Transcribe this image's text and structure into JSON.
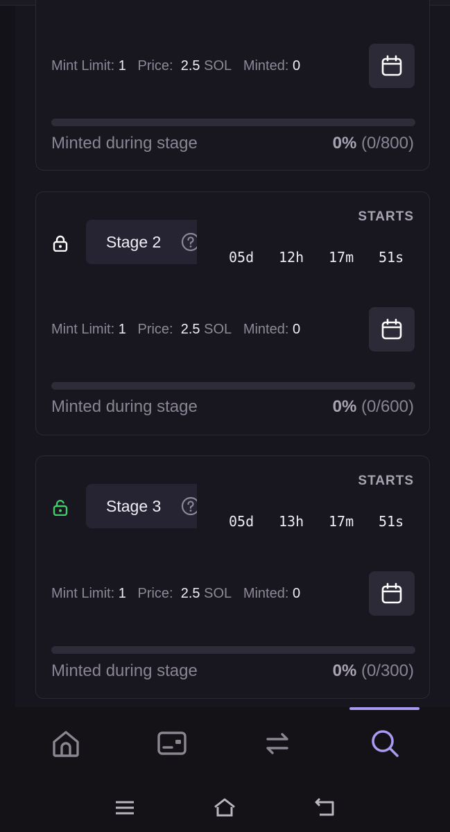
{
  "stages": [
    {
      "name": "",
      "mint_limit_label": "Mint Limit:",
      "mint_limit": "1",
      "price_label": "Price:",
      "price": "2.5",
      "currency": "SOL",
      "minted_label": "Minted:",
      "minted": "0",
      "progress_caption": "Minted during stage",
      "percent": "0%",
      "count": "(0/800)",
      "progress_fraction": 0
    },
    {
      "name": "Stage 2",
      "lock_state": "locked",
      "starts_label": "STARTS",
      "countdown": {
        "d": "05d",
        "h": "12h",
        "m": "17m",
        "s": "51s"
      },
      "mint_limit_label": "Mint Limit:",
      "mint_limit": "1",
      "price_label": "Price:",
      "price": "2.5",
      "currency": "SOL",
      "minted_label": "Minted:",
      "minted": "0",
      "progress_caption": "Minted during stage",
      "percent": "0%",
      "count": "(0/600)",
      "progress_fraction": 0
    },
    {
      "name": "Stage 3",
      "lock_state": "unlocked",
      "starts_label": "STARTS",
      "countdown": {
        "d": "05d",
        "h": "13h",
        "m": "17m",
        "s": "51s"
      },
      "mint_limit_label": "Mint Limit:",
      "mint_limit": "1",
      "price_label": "Price:",
      "price": "2.5",
      "currency": "SOL",
      "minted_label": "Minted:",
      "minted": "0",
      "progress_caption": "Minted during stage",
      "percent": "0%",
      "count": "(0/300)",
      "progress_fraction": 0
    }
  ],
  "bottom_nav": {
    "items": [
      "home-icon",
      "wallet-icon",
      "swap-icon",
      "search-icon"
    ],
    "active": "search-icon",
    "active_color": "#a79bf2"
  },
  "colors": {
    "unlocked_lock": "#3ecf6b",
    "locked_lock": "#ffffff"
  }
}
